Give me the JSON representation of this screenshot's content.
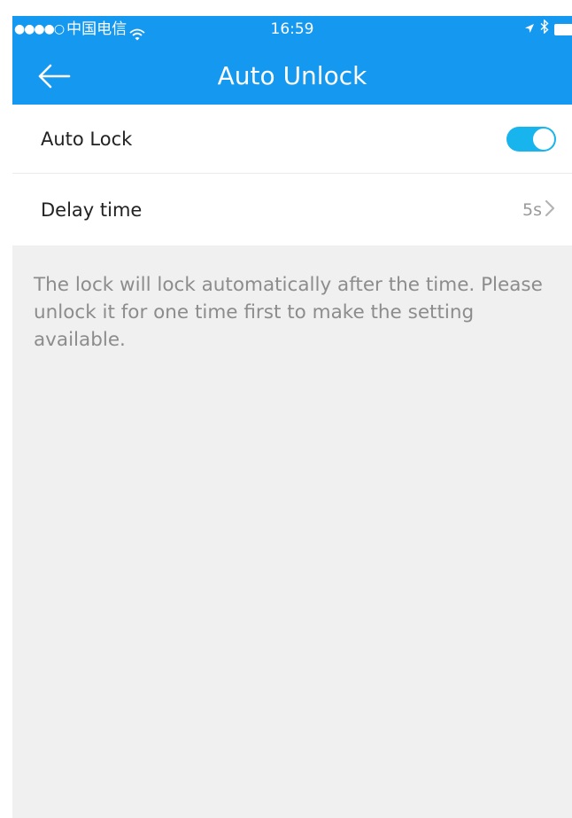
{
  "status_bar": {
    "signal": "●●●●○",
    "carrier": "中国电信",
    "time": "16:59",
    "icons": [
      "wifi-icon",
      "location-icon",
      "bluetooth-icon",
      "battery-icon"
    ]
  },
  "header": {
    "title": "Auto Unlock",
    "back_icon": "back-arrow-icon",
    "background_color": "#1599f0"
  },
  "settings": {
    "auto_lock": {
      "label": "Auto Lock",
      "enabled": true,
      "toggle_color": "#18b4ee"
    },
    "delay_time": {
      "label": "Delay time",
      "value": "5s",
      "icon": "chevron-right-icon"
    }
  },
  "note": {
    "text": "The lock will lock automatically after the time. Please unlock it for one time first to make the setting available."
  }
}
